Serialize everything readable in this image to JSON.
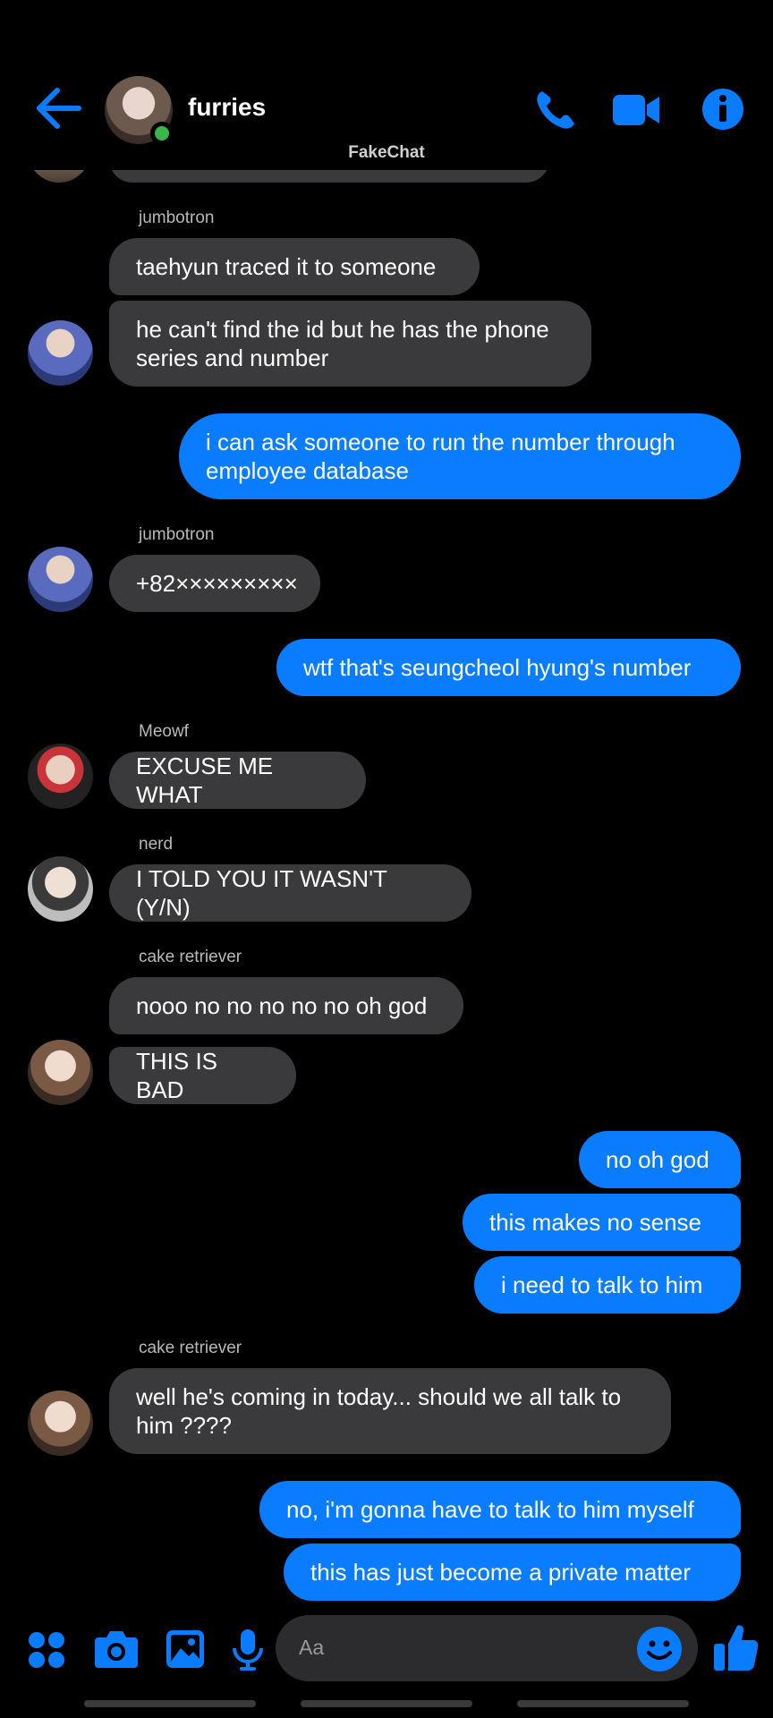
{
  "header": {
    "title": "furries",
    "watermark": "FakeChat",
    "accent": "#0a7cff"
  },
  "messages": [
    {
      "side": "in",
      "sender": "jumbotron",
      "text": "taehyun traced it to someone"
    },
    {
      "side": "in",
      "text": "he can't find the id but he has the phone series and number"
    },
    {
      "side": "out",
      "text": "i can ask someone to run the number through employee database"
    },
    {
      "side": "in",
      "sender": "jumbotron",
      "text": "+82×××××××××"
    },
    {
      "side": "out",
      "text": "wtf that's seungcheol hyung's number"
    },
    {
      "side": "in",
      "sender": "Meowf",
      "text": "EXCUSE ME WHAT"
    },
    {
      "side": "in",
      "sender": "nerd",
      "text": "I TOLD YOU IT WASN'T (Y/N)"
    },
    {
      "side": "in",
      "sender": "cake retriever",
      "text": "nooo no no no no no oh god"
    },
    {
      "side": "in",
      "text": "THIS IS BAD"
    },
    {
      "side": "out",
      "text": "no oh god"
    },
    {
      "side": "out",
      "text": "this makes no sense"
    },
    {
      "side": "out",
      "text": "i need to talk to him"
    },
    {
      "side": "in",
      "sender": "cake retriever",
      "text": "well he's coming in today... should we all talk to him ????"
    },
    {
      "side": "out",
      "text": "no, i'm gonna have to talk to him myself"
    },
    {
      "side": "out",
      "text": "this has just become a private matter"
    }
  ],
  "composer": {
    "placeholder": "Aa",
    "icons": [
      "menu-dots-icon",
      "camera-icon",
      "gallery-icon",
      "microphone-icon",
      "emoji-icon",
      "thumbs-up-icon"
    ]
  }
}
